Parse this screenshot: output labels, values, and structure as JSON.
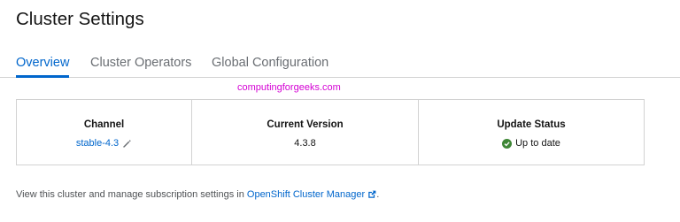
{
  "page": {
    "title": "Cluster Settings"
  },
  "tabs": [
    {
      "label": "Overview",
      "active": true
    },
    {
      "label": "Cluster Operators",
      "active": false
    },
    {
      "label": "Global Configuration",
      "active": false
    }
  ],
  "watermark": "computingforgeeks.com",
  "summary": {
    "channel": {
      "label": "Channel",
      "value": "stable-4.3",
      "icon": "pencil-icon"
    },
    "current_version": {
      "label": "Current Version",
      "value": "4.3.8"
    },
    "update_status": {
      "label": "Update Status",
      "value": "Up to date",
      "icon": "check-circle-icon",
      "icon_color": "#3e8635"
    }
  },
  "footer": {
    "text": "View this cluster and manage subscription settings in ",
    "link_label": "OpenShift Cluster Manager",
    "link_icon": "external-link-icon",
    "suffix": "."
  },
  "colors": {
    "accent": "#0066cc",
    "success": "#3e8635",
    "watermark": "#d400d4"
  }
}
